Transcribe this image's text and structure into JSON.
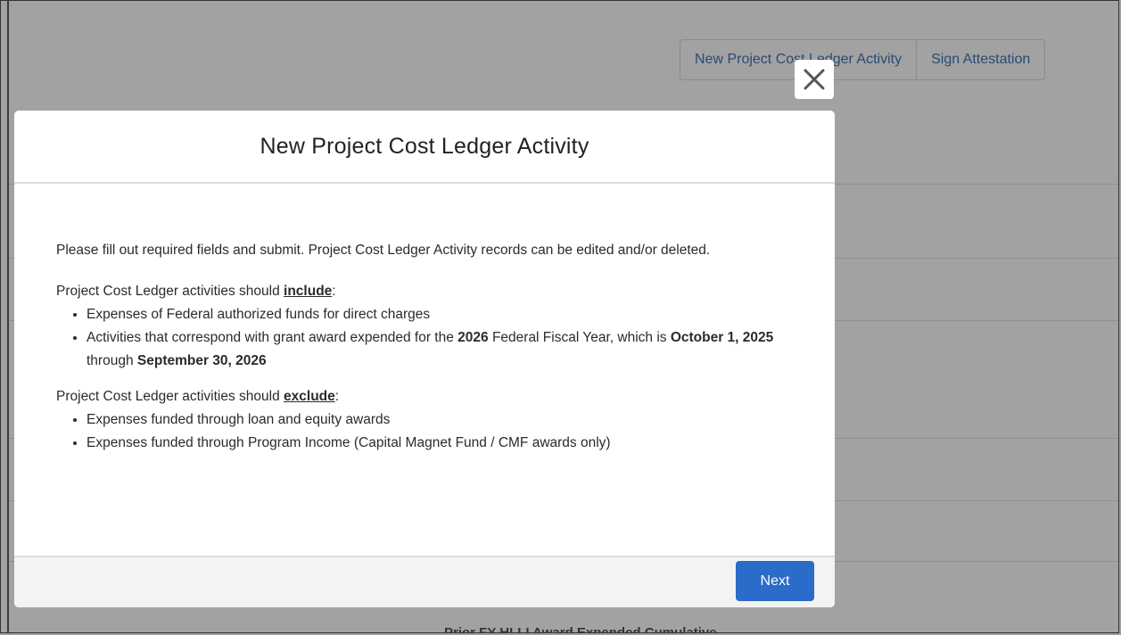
{
  "background": {
    "actions": [
      {
        "label": "New Project Cost Ledger Activity"
      },
      {
        "label": "Sign Attestation"
      }
    ],
    "bottom_text": "Prior FY HLLI Award Expended Cumulative"
  },
  "modal": {
    "title": "New Project Cost Ledger Activity",
    "intro": "Please fill out required fields and submit. Project Cost Ledger Activity records can be edited and/or deleted.",
    "include": {
      "lead": "Project Cost Ledger activities should ",
      "keyword": "include",
      "colon": ":",
      "items": [
        "Expenses of Federal authorized funds for direct charges"
      ],
      "item2": {
        "part1": "Activities that correspond with grant award expended for the ",
        "year": "2026",
        "part2": " Federal Fiscal Year, which is ",
        "start": "October 1, 2025",
        "through": " through ",
        "end": "September 30, 2026"
      }
    },
    "exclude": {
      "lead": "Project Cost Ledger activities should ",
      "keyword": "exclude",
      "colon": ":",
      "items": [
        "Expenses funded through loan and equity awards",
        "Expenses funded through Program Income (Capital Magnet Fund / CMF awards only)"
      ]
    },
    "next_label": "Next"
  }
}
